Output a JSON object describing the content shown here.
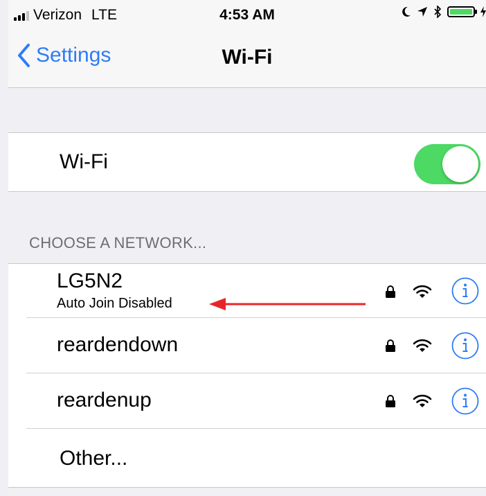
{
  "status_bar": {
    "carrier": "Verizon",
    "network_type": "LTE",
    "time": "4:53 AM",
    "icons": [
      "signal-icon",
      "moon-icon",
      "location-icon",
      "bluetooth-icon",
      "battery-icon",
      "charging-icon"
    ]
  },
  "nav": {
    "back_label": "Settings",
    "title": "Wi-Fi"
  },
  "wifi": {
    "label": "Wi-Fi",
    "enabled": true
  },
  "section_header": "CHOOSE A NETWORK...",
  "networks": [
    {
      "name": "LG5N2",
      "subtitle": "Auto Join Disabled",
      "secured": true
    },
    {
      "name": "reardendown",
      "secured": true
    },
    {
      "name": "reardenup",
      "secured": true
    }
  ],
  "other_label": "Other...",
  "colors": {
    "accent": "#2e7cf6",
    "toggle_on": "#4cd964",
    "annotation_arrow": "#e8262a"
  }
}
